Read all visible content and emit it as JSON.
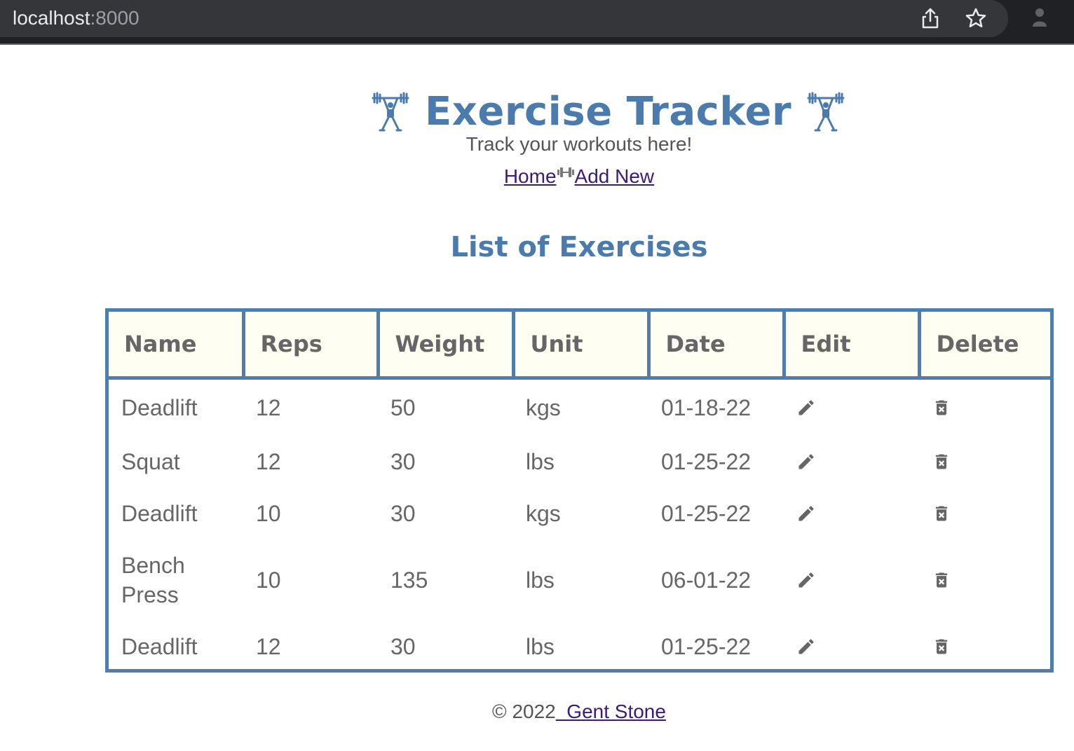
{
  "browser": {
    "url_host": "localhost",
    "url_port": ":8000"
  },
  "header": {
    "title": "Exercise Tracker",
    "tagline": "Track your workouts here!",
    "icon": "weightlifter-icon"
  },
  "nav": {
    "home_label": "Home",
    "add_new_label": "Add New",
    "separator_icon": "dumbbell-icon"
  },
  "section_title": "List of Exercises",
  "table": {
    "columns": [
      "Name",
      "Reps",
      "Weight",
      "Unit",
      "Date",
      "Edit",
      "Delete"
    ],
    "rows": [
      {
        "name": "Deadlift",
        "reps": "12",
        "weight": "50",
        "unit": "kgs",
        "date": "01-18-22"
      },
      {
        "name": "Squat",
        "reps": "12",
        "weight": "30",
        "unit": "lbs",
        "date": "01-25-22"
      },
      {
        "name": "Deadlift",
        "reps": "10",
        "weight": "30",
        "unit": "kgs",
        "date": "01-25-22"
      },
      {
        "name": "Bench Press",
        "reps": "10",
        "weight": "135",
        "unit": "lbs",
        "date": "06-01-22"
      },
      {
        "name": "Deadlift",
        "reps": "12",
        "weight": "30",
        "unit": "lbs",
        "date": "01-25-22"
      }
    ],
    "edit_icon": "pencil-icon",
    "delete_icon": "trash-icon"
  },
  "footer": {
    "copyright": "© 2022",
    "author_link": "  Gent Stone"
  },
  "colors": {
    "accent": "#4b7bad",
    "header_bg": "#fefff2",
    "link": "#3d1a7a",
    "text": "#666666"
  }
}
